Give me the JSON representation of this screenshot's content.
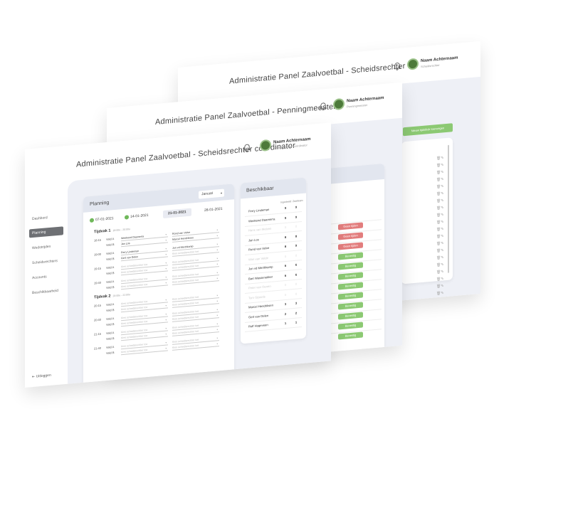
{
  "screens": {
    "back": {
      "title": "Administratie Panel Zaalvoetbal - Scheidsrechter",
      "user_name": "Naam Achternaam",
      "user_role": "Scheidsrechter",
      "action_button": "Nieuw tijdsblok toevoegen",
      "status_buttons": [
        "Geen tijden",
        "Geen tijden",
        "Geen tijden",
        "Bevestig",
        "Bevestig",
        "Bevestig",
        "Bevestig",
        "Bevestig",
        "Bevestig",
        "Bevestig",
        "Bevestig",
        "Bevestig"
      ]
    },
    "middle": {
      "title": "Administratie Panel Zaalvoetbal - Penningmeester",
      "user_name": "Naam Achternaam",
      "user_role": "Penningmeester"
    },
    "front": {
      "title": "Administratie Panel Zaalvoetbal - Scheidsrechter coördinator",
      "user_name": "Naam Achternaam",
      "user_role": "Scheidsrechter coördinator",
      "nav": [
        "Dashbord",
        "Planning",
        "Wedstrijden",
        "Scheidsrechters",
        "Accounts",
        "Beschikbaarheid"
      ],
      "logout": "Uitloggen",
      "planning": {
        "title": "Planning",
        "month": "Januari",
        "dates": [
          "07-01-2021",
          "14-01-2021",
          "21-01-2021",
          "28-01-2021"
        ],
        "tijdvak1_label": "Tijdvak 1",
        "tijdvak1_time": "18:00u - 20:00u",
        "tijdvak2_label": "Tijdvak 2",
        "tijdvak2_time": "20:00u - 22:00u",
        "times": [
          "18:15",
          "19:00",
          "19:15",
          "19:40",
          "20:15",
          "20:40",
          "21:15",
          "21:40"
        ],
        "veld_a": "Veld A",
        "veld_b": "Veld B",
        "placeholder": "Kies scheidsrechter toe",
        "assigned": [
          [
            "Weekend Daamerra",
            "Rond van Velve"
          ],
          [
            "Jan Los",
            "Marcel Hendriksen"
          ],
          [
            "Ferry Lindeman",
            "Jon vd Merthkamp"
          ],
          [
            "Gert van Delen",
            "Kies scheidsrechter toe"
          ]
        ]
      },
      "beschikbaar": {
        "title": "Beschikbaar",
        "col1": "Ingedeeld",
        "col2": "Zaalteam",
        "rows": [
          {
            "name": "Ferry Lindeman",
            "a": "9",
            "b": "9",
            "dim": false
          },
          {
            "name": "Weekend Daamerra",
            "a": "9",
            "b": "9",
            "dim": false
          },
          {
            "name": "Hans van Melzen",
            "a": "0",
            "b": "0",
            "dim": true
          },
          {
            "name": "Jan Los",
            "a": "8",
            "b": "8",
            "dim": false
          },
          {
            "name": "Rond van Velve",
            "a": "8",
            "b": "9",
            "dim": false
          },
          {
            "name": "Wim van Velde",
            "a": "0",
            "b": "0",
            "dim": true
          },
          {
            "name": "Jon vd Merthkamp",
            "a": "6",
            "b": "6",
            "dim": false
          },
          {
            "name": "Bart Wassenekker",
            "a": "6",
            "b": "6",
            "dim": false
          },
          {
            "name": "Peter van Oenen",
            "a": "0",
            "b": "0",
            "dim": true
          },
          {
            "name": "Tom Gijssels",
            "a": "0",
            "b": "0",
            "dim": true
          },
          {
            "name": "Marcel Hendriksen",
            "a": "3",
            "b": "3",
            "dim": false
          },
          {
            "name": "Gert van Delen",
            "a": "2",
            "b": "2",
            "dim": false
          },
          {
            "name": "Rolf Hogeveen",
            "a": "1",
            "b": "1",
            "dim": false
          }
        ]
      }
    }
  }
}
